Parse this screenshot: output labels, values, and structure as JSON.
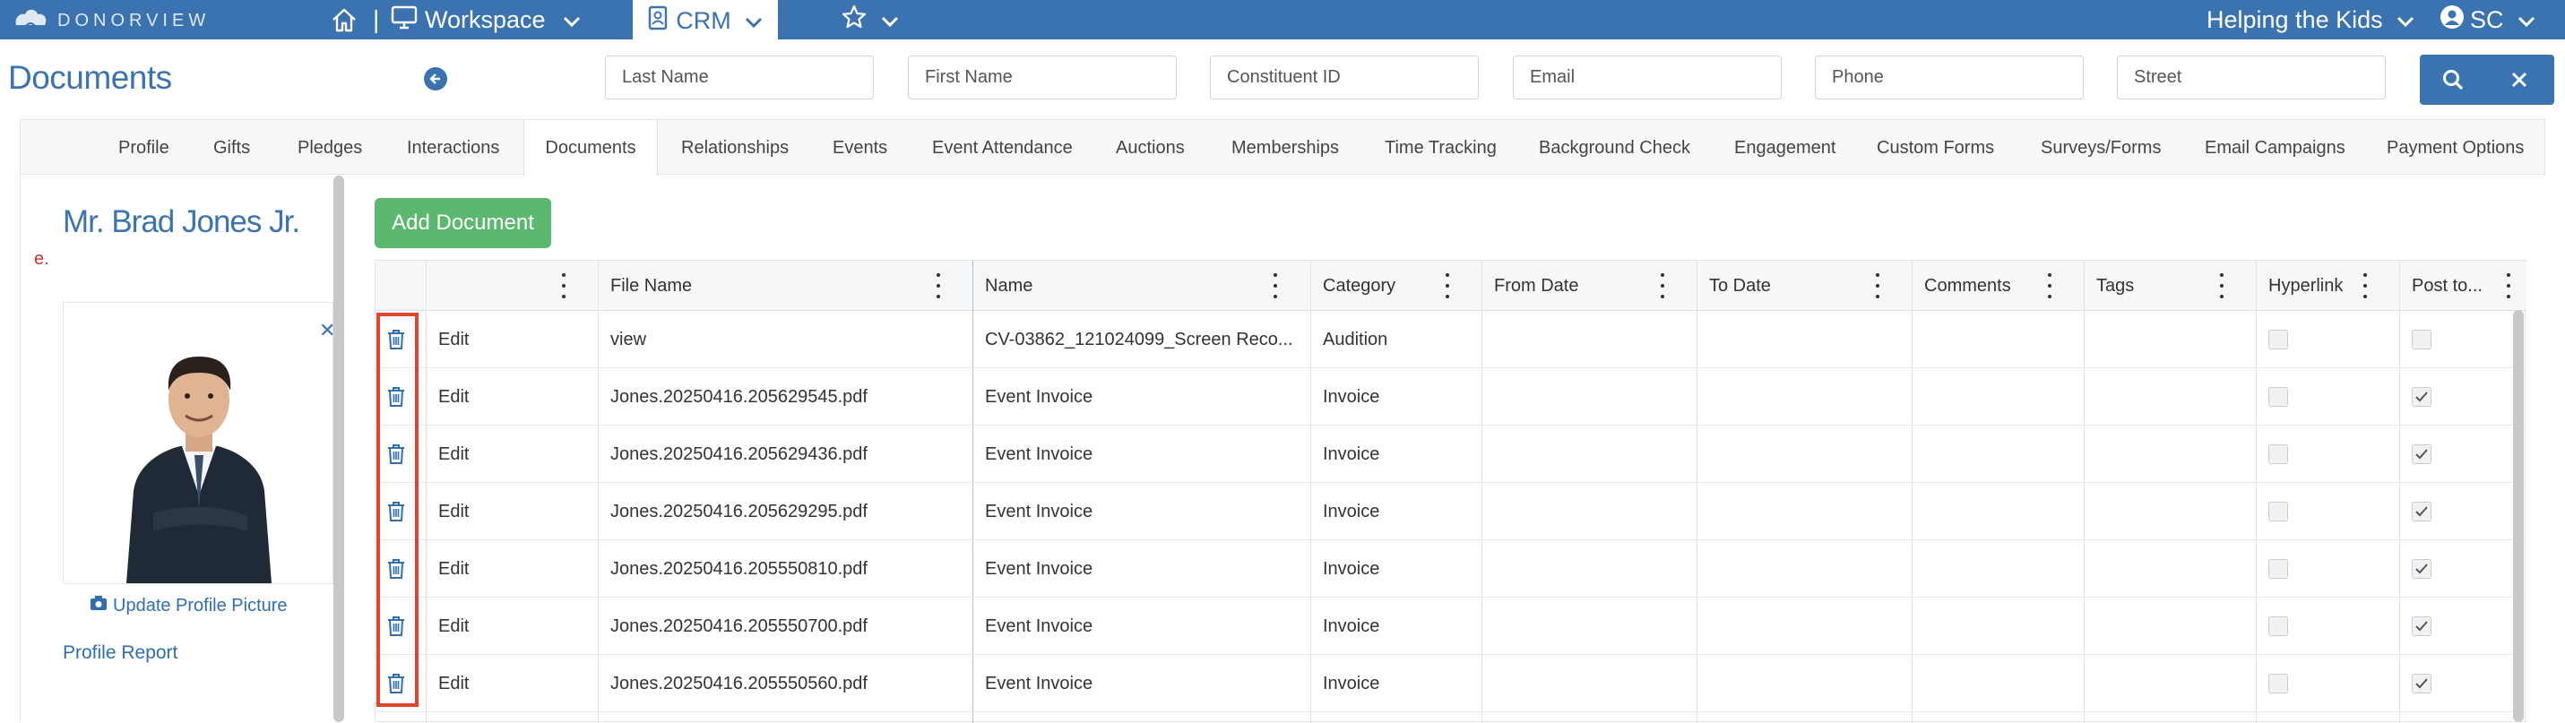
{
  "topbar": {
    "brand": "DONORVIEW",
    "workspace_label": "Workspace",
    "crm_label": "CRM",
    "org_label": "Helping the Kids",
    "user_initials": "SC",
    "bg_color": "#3b72b0"
  },
  "header": {
    "page_title": "Documents",
    "search_fields": [
      {
        "placeholder": "Last Name"
      },
      {
        "placeholder": "First Name"
      },
      {
        "placeholder": "Constituent ID"
      },
      {
        "placeholder": "Email"
      },
      {
        "placeholder": "Phone"
      },
      {
        "placeholder": "Street"
      }
    ]
  },
  "tabs": [
    {
      "label": "Profile"
    },
    {
      "label": "Gifts"
    },
    {
      "label": "Pledges"
    },
    {
      "label": "Interactions"
    },
    {
      "label": "Documents",
      "active": true
    },
    {
      "label": "Relationships"
    },
    {
      "label": "Events"
    },
    {
      "label": "Event Attendance"
    },
    {
      "label": "Auctions"
    },
    {
      "label": "Memberships"
    },
    {
      "label": "Time Tracking"
    },
    {
      "label": "Background Check"
    },
    {
      "label": "Engagement"
    },
    {
      "label": "Custom Forms"
    },
    {
      "label": "Surveys/Forms"
    },
    {
      "label": "Email Campaigns"
    },
    {
      "label": "Payment Options"
    }
  ],
  "profile": {
    "name": "Mr. Brad Jones Jr.",
    "red_mark": "e.",
    "update_picture": "Update Profile Picture",
    "profile_report": "Profile Report"
  },
  "grid": {
    "add_button": "Add Document",
    "columns": [
      "File Name",
      "Name",
      "Category",
      "From Date",
      "To Date",
      "Comments",
      "Tags",
      "Hyperlink",
      "Post to..."
    ],
    "edit_label": "Edit",
    "rows": [
      {
        "file": "view",
        "name": "CV-03862_121024099_Screen Reco...",
        "category": "Audition",
        "hyperlink": false,
        "post": false
      },
      {
        "file": "Jones.20250416.205629545.pdf",
        "name": "Event Invoice",
        "category": "Invoice",
        "hyperlink": false,
        "post": true
      },
      {
        "file": "Jones.20250416.205629436.pdf",
        "name": "Event Invoice",
        "category": "Invoice",
        "hyperlink": false,
        "post": true
      },
      {
        "file": "Jones.20250416.205629295.pdf",
        "name": "Event Invoice",
        "category": "Invoice",
        "hyperlink": false,
        "post": true
      },
      {
        "file": "Jones.20250416.205550810.pdf",
        "name": "Event Invoice",
        "category": "Invoice",
        "hyperlink": false,
        "post": true
      },
      {
        "file": "Jones.20250416.205550700.pdf",
        "name": "Event Invoice",
        "category": "Invoice",
        "hyperlink": false,
        "post": true
      },
      {
        "file": "Jones.20250416.205550560.pdf",
        "name": "Event Invoice",
        "category": "Invoice",
        "hyperlink": false,
        "post": true
      }
    ]
  }
}
